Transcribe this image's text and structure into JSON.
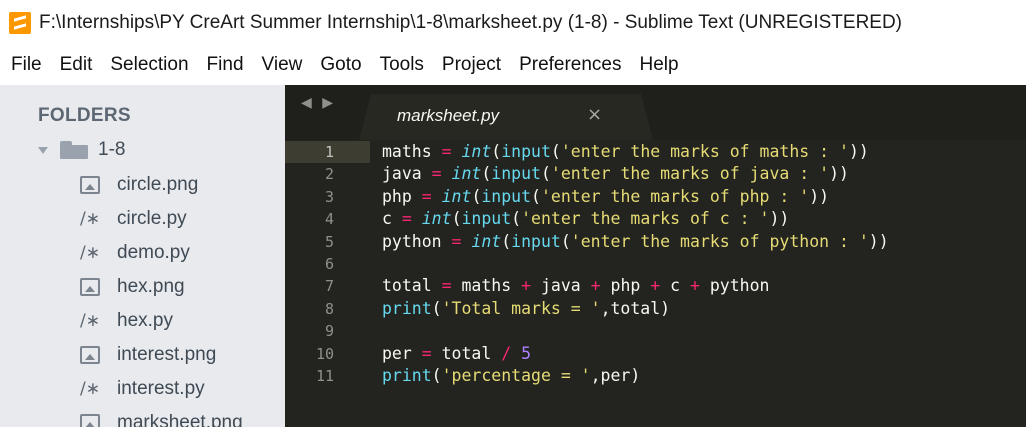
{
  "window": {
    "title": "F:\\Internships\\PY CreArt Summer Internship\\1-8\\marksheet.py (1-8) - Sublime Text (UNREGISTERED)"
  },
  "menu": [
    "File",
    "Edit",
    "Selection",
    "Find",
    "View",
    "Goto",
    "Tools",
    "Project",
    "Preferences",
    "Help"
  ],
  "sidebar": {
    "heading": "FOLDERS",
    "folder": "1-8",
    "files": [
      {
        "name": "circle.png",
        "icon": "image-file-icon"
      },
      {
        "name": "circle.py",
        "icon": "code-file-icon"
      },
      {
        "name": "demo.py",
        "icon": "code-file-icon"
      },
      {
        "name": "hex.png",
        "icon": "image-file-icon"
      },
      {
        "name": "hex.py",
        "icon": "code-file-icon"
      },
      {
        "name": "interest.png",
        "icon": "image-file-icon"
      },
      {
        "name": "interest.py",
        "icon": "code-file-icon"
      },
      {
        "name": "marksheet.png",
        "icon": "image-file-icon"
      }
    ]
  },
  "editor": {
    "nav_arrows": "◀ ▶",
    "tab": {
      "label": "marksheet.py",
      "close": "×"
    },
    "current_line": 1,
    "lines": [
      {
        "n": "1",
        "text": "maths = int(input('enter the marks of maths : '))"
      },
      {
        "n": "2",
        "text": "java = int(input('enter the marks of java : '))"
      },
      {
        "n": "3",
        "text": "php = int(input('enter the marks of php : '))"
      },
      {
        "n": "4",
        "text": "c = int(input('enter the marks of c : '))"
      },
      {
        "n": "5",
        "text": "python = int(input('enter the marks of python : '))"
      },
      {
        "n": "6",
        "text": ""
      },
      {
        "n": "7",
        "text": "total = maths + java + php + c + python"
      },
      {
        "n": "8",
        "text": "print('Total marks = ',total)"
      },
      {
        "n": "9",
        "text": ""
      },
      {
        "n": "10",
        "text": "per = total / 5"
      },
      {
        "n": "11",
        "text": "print('percentage = ',per)"
      }
    ]
  },
  "colors": {
    "editor_bg": "#23241f",
    "sidebar_bg": "#e8eaed",
    "keyword": "#66d9ef",
    "operator": "#f92672",
    "string": "#e6db74",
    "number": "#ae81ff"
  }
}
